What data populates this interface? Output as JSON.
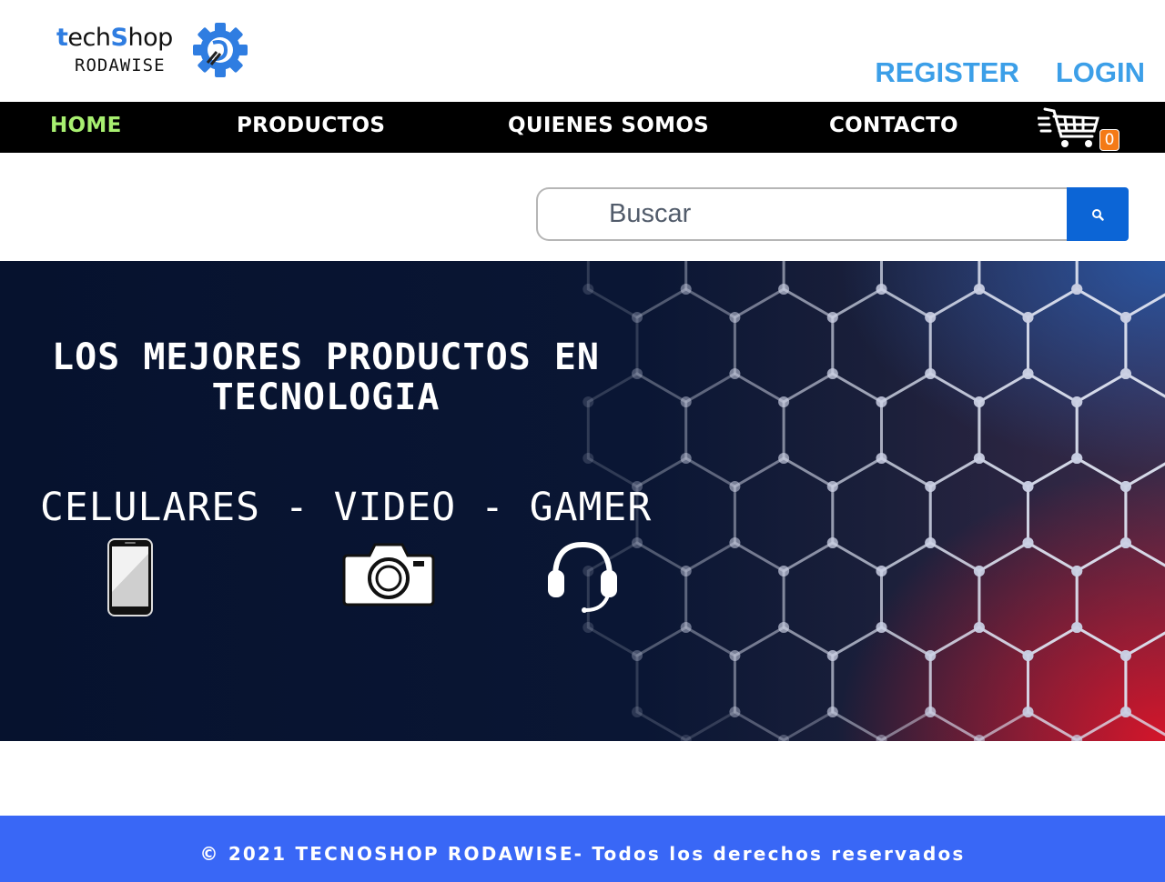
{
  "brand": {
    "logo_top_t": "t",
    "logo_top_ech": "ech",
    "logo_top_s": "S",
    "logo_top_hop": "hop",
    "logo_bottom": "RODAWISE"
  },
  "auth": {
    "register": "REGISTER",
    "login": "LOGIN",
    "color": "#3c9fe8"
  },
  "nav": {
    "home": "HOME",
    "products": "PRODUCTOS",
    "about": "QUIENES SOMOS",
    "contact": "CONTACTO",
    "active_color": "#a8f070",
    "cart_count": "0",
    "cart_icon": "shopping-cart-icon"
  },
  "search": {
    "placeholder": "Buscar",
    "button_icon": "search-icon",
    "button_color": "#0c65d6"
  },
  "hero": {
    "title": "LOS MEJORES PRODUCTOS EN TECNOLOGIA",
    "subtitle": "CELULARES - VIDEO - GAMER",
    "icons": [
      "smartphone-icon",
      "camera-icon",
      "headset-icon"
    ]
  },
  "footer": {
    "text": "© 2021 TECNOSHOP RODAWISE- Todos los derechos reservados",
    "color": "#3967f6"
  }
}
